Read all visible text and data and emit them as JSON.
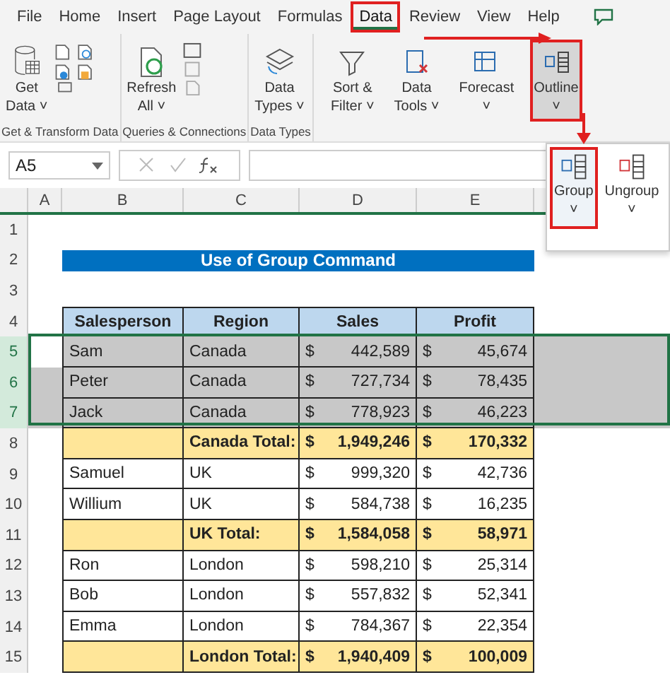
{
  "ribbon_tabs": [
    {
      "label": "File",
      "selected": false,
      "annotated": false
    },
    {
      "label": "Home",
      "selected": false,
      "annotated": false
    },
    {
      "label": "Insert",
      "selected": false,
      "annotated": false
    },
    {
      "label": "Page Layout",
      "selected": false,
      "annotated": false
    },
    {
      "label": "Formulas",
      "selected": false,
      "annotated": false
    },
    {
      "label": "Data",
      "selected": true,
      "annotated": true
    },
    {
      "label": "Review",
      "selected": false,
      "annotated": false
    },
    {
      "label": "View",
      "selected": false,
      "annotated": false
    },
    {
      "label": "Help",
      "selected": false,
      "annotated": false
    }
  ],
  "ribbon_groups": [
    {
      "label": "Get & Transform Data",
      "buttons": [
        {
          "kind": "get-data",
          "lines": [
            "Get",
            "Data ˅"
          ],
          "selected": false,
          "annotated": false
        }
      ]
    },
    {
      "label": "Queries & Connections",
      "buttons": [
        {
          "kind": "refresh",
          "lines": [
            "Refresh",
            "All ˅"
          ],
          "selected": false,
          "annotated": false
        }
      ]
    },
    {
      "label": "Data Types",
      "buttons": [
        {
          "kind": "data-types",
          "lines": [
            "Data",
            "Types ˅"
          ],
          "selected": false,
          "annotated": false
        }
      ]
    },
    {
      "buttons": [
        {
          "kind": "filter",
          "lines": [
            "Sort &",
            "Filter ˅"
          ],
          "selected": false,
          "annotated": false
        },
        {
          "kind": "data-tools",
          "lines": [
            "Data",
            "Tools ˅"
          ],
          "selected": false,
          "annotated": false
        },
        {
          "kind": "forecast",
          "lines": [
            "Forecast",
            "˅"
          ],
          "selected": false,
          "annotated": false
        },
        {
          "kind": "outline",
          "lines": [
            "Outline",
            "˅"
          ],
          "selected": true,
          "annotated": true
        }
      ]
    }
  ],
  "name_box": "A5",
  "columns": [
    "A",
    "B",
    "C",
    "D",
    "E"
  ],
  "rows": [
    {
      "number": "1",
      "kind": "blank",
      "selected": false
    },
    {
      "number": "2",
      "kind": "title",
      "selected": false,
      "title": "Use of Group Command"
    },
    {
      "number": "3",
      "kind": "blank",
      "selected": false
    },
    {
      "number": "4",
      "kind": "header",
      "selected": false,
      "cells": [
        "Salesperson",
        "Region",
        "Sales",
        "Profit"
      ]
    },
    {
      "number": "5",
      "kind": "data",
      "selected": true,
      "cells": [
        "Sam",
        "Canada",
        "$",
        "442,589",
        "$",
        "45,674"
      ]
    },
    {
      "number": "6",
      "kind": "data",
      "selected": true,
      "cells": [
        "Peter",
        "Canada",
        "$",
        "727,734",
        "$",
        "78,435"
      ]
    },
    {
      "number": "7",
      "kind": "data",
      "selected": true,
      "cells": [
        "Jack",
        "Canada",
        "$",
        "778,923",
        "$",
        "46,223"
      ]
    },
    {
      "number": "8",
      "kind": "total",
      "selected": false,
      "cells": [
        "",
        "Canada Total:",
        "$",
        "1,949,246",
        "$",
        "170,332"
      ]
    },
    {
      "number": "9",
      "kind": "data",
      "selected": false,
      "cells": [
        "Samuel",
        "UK",
        "$",
        "999,320",
        "$",
        "42,736"
      ]
    },
    {
      "number": "10",
      "kind": "data",
      "selected": false,
      "cells": [
        "Willium",
        "UK",
        "$",
        "584,738",
        "$",
        "16,235"
      ]
    },
    {
      "number": "11",
      "kind": "total",
      "selected": false,
      "cells": [
        "",
        "UK Total:",
        "$",
        "1,584,058",
        "$",
        "58,971"
      ]
    },
    {
      "number": "12",
      "kind": "data",
      "selected": false,
      "cells": [
        "Ron",
        "London",
        "$",
        "598,210",
        "$",
        "25,314"
      ]
    },
    {
      "number": "13",
      "kind": "data",
      "selected": false,
      "cells": [
        "Bob",
        "London",
        "$",
        "557,832",
        "$",
        "52,341"
      ]
    },
    {
      "number": "14",
      "kind": "data",
      "selected": false,
      "cells": [
        "Emma",
        "London",
        "$",
        "784,367",
        "$",
        "22,354"
      ]
    },
    {
      "number": "15",
      "kind": "total",
      "selected": false,
      "cells": [
        "",
        "London Total:",
        "$",
        "1,940,409",
        "$",
        "100,009"
      ]
    }
  ],
  "outline_menu": [
    {
      "label": "Group",
      "caret": "˅",
      "selected": true,
      "annotated": true
    },
    {
      "label": "Ungroup",
      "caret": "˅",
      "selected": false,
      "annotated": false
    }
  ]
}
